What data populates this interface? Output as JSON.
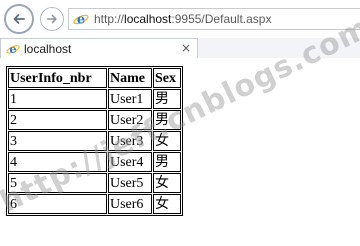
{
  "browser": {
    "address": {
      "prefix": "http://",
      "host": "localhost",
      "rest": ":9955/Default.aspx"
    },
    "tab": {
      "title": "localhost",
      "close_glyph": "×"
    },
    "icons": {
      "back": "back-arrow-icon",
      "forward": "forward-arrow-icon",
      "page": "ie-logo-icon"
    }
  },
  "table": {
    "headers": [
      "UserInfo_nbr",
      "Name",
      "Sex"
    ],
    "rows": [
      [
        "1",
        "User1",
        "男"
      ],
      [
        "2",
        "User2",
        "男"
      ],
      [
        "3",
        "User3",
        "女"
      ],
      [
        "4",
        "User4",
        "男"
      ],
      [
        "5",
        "User5",
        "女"
      ],
      [
        "6",
        "User6",
        "女"
      ]
    ]
  },
  "watermark": "http://jeff.cnblogs.com/"
}
